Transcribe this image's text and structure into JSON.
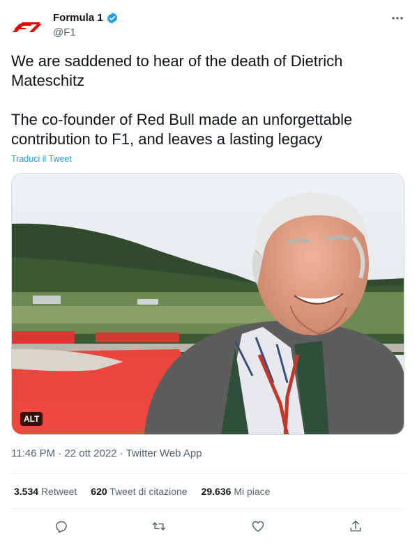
{
  "author": {
    "name": "Formula 1",
    "handle": "@F1",
    "verified": true,
    "brand_color": "#e10600"
  },
  "tweet": {
    "paragraphs": [
      "We are saddened to hear of the death of Dietrich Mateschitz",
      "The co-founder of Red Bull made an unforgettable contribution to F1, and leaves a lasting legacy"
    ],
    "translate_label": "Traduci il Tweet",
    "media_alt_label": "ALT"
  },
  "meta": {
    "time": "11:46 PM",
    "separator": "·",
    "date": "22 ott 2022",
    "source": "Twitter Web App"
  },
  "stats": [
    {
      "value": "3.534",
      "label": "Retweet"
    },
    {
      "value": "620",
      "label": "Tweet di citazione"
    },
    {
      "value": "29.636",
      "label": "Mi piace"
    }
  ],
  "icons": {
    "more": "more-icon",
    "verified": "verified-badge-icon",
    "reply": "reply-icon",
    "retweet": "retweet-icon",
    "like": "like-icon",
    "share": "share-icon"
  },
  "colors": {
    "accent": "#1d9bf0",
    "text": "#0f1419",
    "muted": "#536471"
  }
}
